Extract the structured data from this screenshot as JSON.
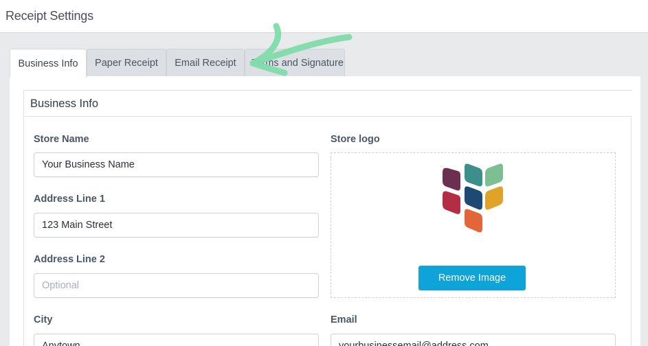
{
  "header": {
    "title": "Receipt Settings"
  },
  "tabs": [
    {
      "label": "Business Info",
      "active": true
    },
    {
      "label": "Paper Receipt",
      "active": false
    },
    {
      "label": "Email Receipt",
      "active": false
    },
    {
      "label": "Terms and Signature",
      "active": false
    }
  ],
  "section": {
    "title": "Business Info"
  },
  "form": {
    "store_name": {
      "label": "Store Name",
      "value": "Your Business Name"
    },
    "address1": {
      "label": "Address Line 1",
      "value": "123 Main Street"
    },
    "address2": {
      "label": "Address Line 2",
      "placeholder": "Optional"
    },
    "city": {
      "label": "City",
      "value": "Anytown"
    },
    "email": {
      "label": "Email",
      "value": "yourbusinessemail@address.com"
    },
    "logo": {
      "label": "Store logo",
      "remove_label": "Remove Image"
    }
  },
  "colors": {
    "accent": "#0ea3d9",
    "annotation_arrow": "#7fdcab",
    "logo": [
      "#6d2f4f",
      "#3c8f8a",
      "#7bbf92",
      "#b32d45",
      "#1c4a73",
      "#e0a32a",
      "#e3653a"
    ]
  },
  "icons": {
    "annotation": "arrow-annotation-icon",
    "logo": "store-logo-icon"
  }
}
